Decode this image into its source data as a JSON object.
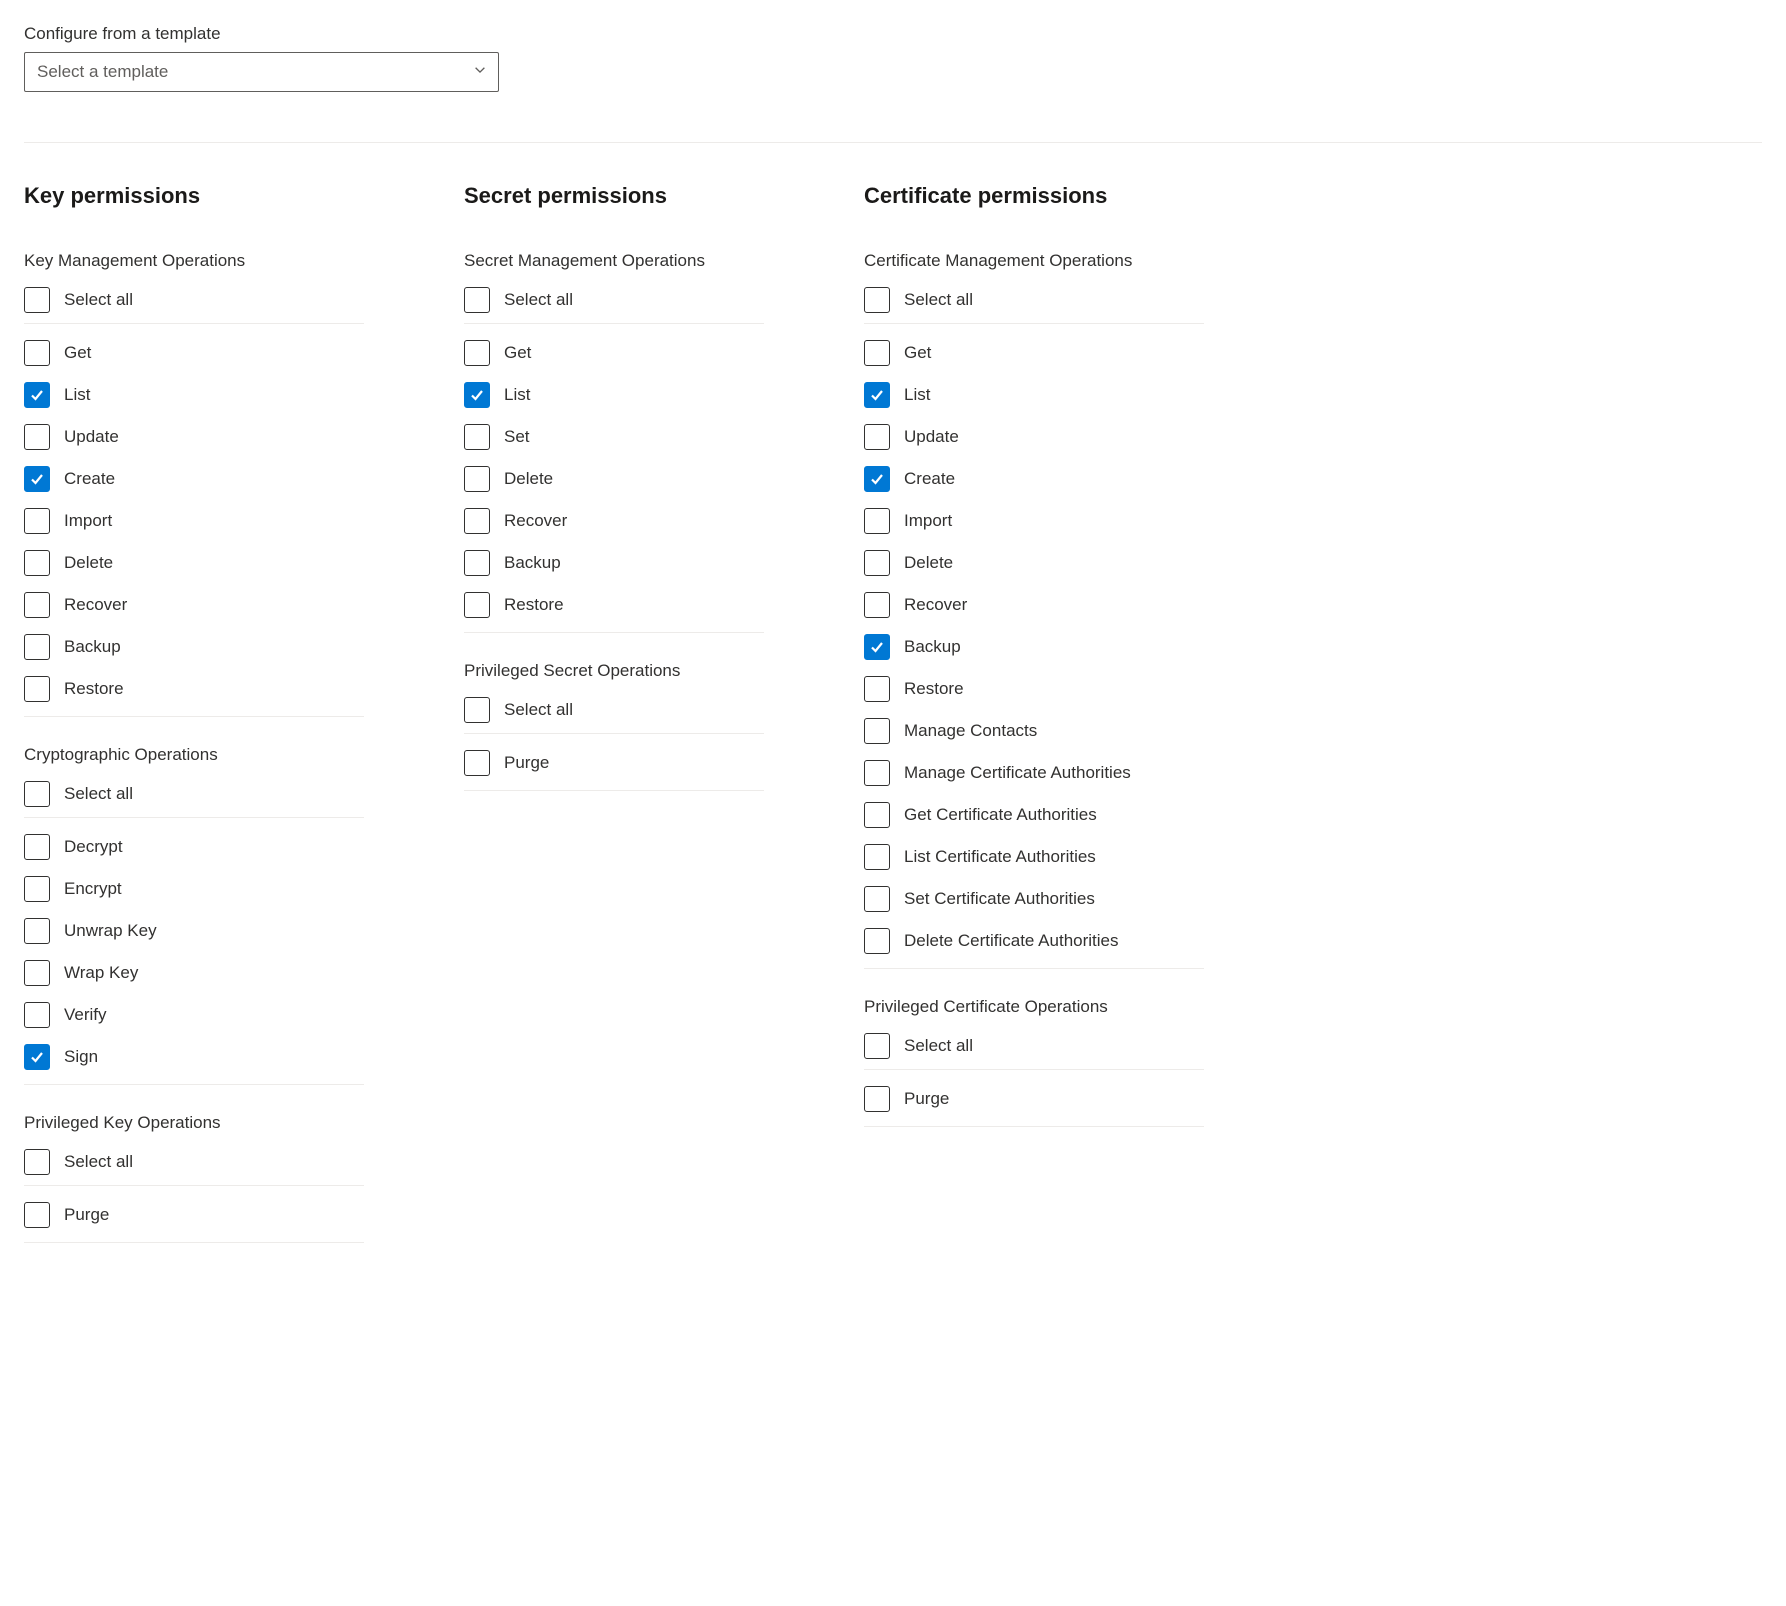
{
  "template": {
    "label": "Configure from a template",
    "placeholder": "Select a template"
  },
  "columns": [
    {
      "heading": "Key permissions",
      "groups": [
        {
          "title": "Key Management Operations",
          "selectAllLabel": "Select all",
          "selectAllChecked": false,
          "options": [
            {
              "label": "Get",
              "checked": false
            },
            {
              "label": "List",
              "checked": true
            },
            {
              "label": "Update",
              "checked": false
            },
            {
              "label": "Create",
              "checked": true
            },
            {
              "label": "Import",
              "checked": false
            },
            {
              "label": "Delete",
              "checked": false
            },
            {
              "label": "Recover",
              "checked": false
            },
            {
              "label": "Backup",
              "checked": false
            },
            {
              "label": "Restore",
              "checked": false
            }
          ]
        },
        {
          "title": "Cryptographic Operations",
          "selectAllLabel": "Select all",
          "selectAllChecked": false,
          "options": [
            {
              "label": "Decrypt",
              "checked": false
            },
            {
              "label": "Encrypt",
              "checked": false
            },
            {
              "label": "Unwrap Key",
              "checked": false
            },
            {
              "label": "Wrap Key",
              "checked": false
            },
            {
              "label": "Verify",
              "checked": false
            },
            {
              "label": "Sign",
              "checked": true
            }
          ]
        },
        {
          "title": "Privileged Key Operations",
          "selectAllLabel": "Select all",
          "selectAllChecked": false,
          "options": [
            {
              "label": "Purge",
              "checked": false
            }
          ]
        }
      ]
    },
    {
      "heading": "Secret permissions",
      "groups": [
        {
          "title": "Secret Management Operations",
          "selectAllLabel": "Select all",
          "selectAllChecked": false,
          "options": [
            {
              "label": "Get",
              "checked": false
            },
            {
              "label": "List",
              "checked": true
            },
            {
              "label": "Set",
              "checked": false
            },
            {
              "label": "Delete",
              "checked": false
            },
            {
              "label": "Recover",
              "checked": false
            },
            {
              "label": "Backup",
              "checked": false
            },
            {
              "label": "Restore",
              "checked": false
            }
          ]
        },
        {
          "title": "Privileged Secret Operations",
          "selectAllLabel": "Select all",
          "selectAllChecked": false,
          "options": [
            {
              "label": "Purge",
              "checked": false
            }
          ]
        }
      ]
    },
    {
      "heading": "Certificate permissions",
      "groups": [
        {
          "title": "Certificate Management Operations",
          "selectAllLabel": "Select all",
          "selectAllChecked": false,
          "options": [
            {
              "label": "Get",
              "checked": false
            },
            {
              "label": "List",
              "checked": true
            },
            {
              "label": "Update",
              "checked": false
            },
            {
              "label": "Create",
              "checked": true
            },
            {
              "label": "Import",
              "checked": false
            },
            {
              "label": "Delete",
              "checked": false
            },
            {
              "label": "Recover",
              "checked": false
            },
            {
              "label": "Backup",
              "checked": true
            },
            {
              "label": "Restore",
              "checked": false
            },
            {
              "label": "Manage Contacts",
              "checked": false
            },
            {
              "label": "Manage Certificate Authorities",
              "checked": false
            },
            {
              "label": "Get Certificate Authorities",
              "checked": false
            },
            {
              "label": "List Certificate Authorities",
              "checked": false
            },
            {
              "label": "Set Certificate Authorities",
              "checked": false
            },
            {
              "label": "Delete Certificate Authorities",
              "checked": false
            }
          ]
        },
        {
          "title": "Privileged Certificate Operations",
          "selectAllLabel": "Select all",
          "selectAllChecked": false,
          "options": [
            {
              "label": "Purge",
              "checked": false
            }
          ]
        }
      ]
    }
  ]
}
